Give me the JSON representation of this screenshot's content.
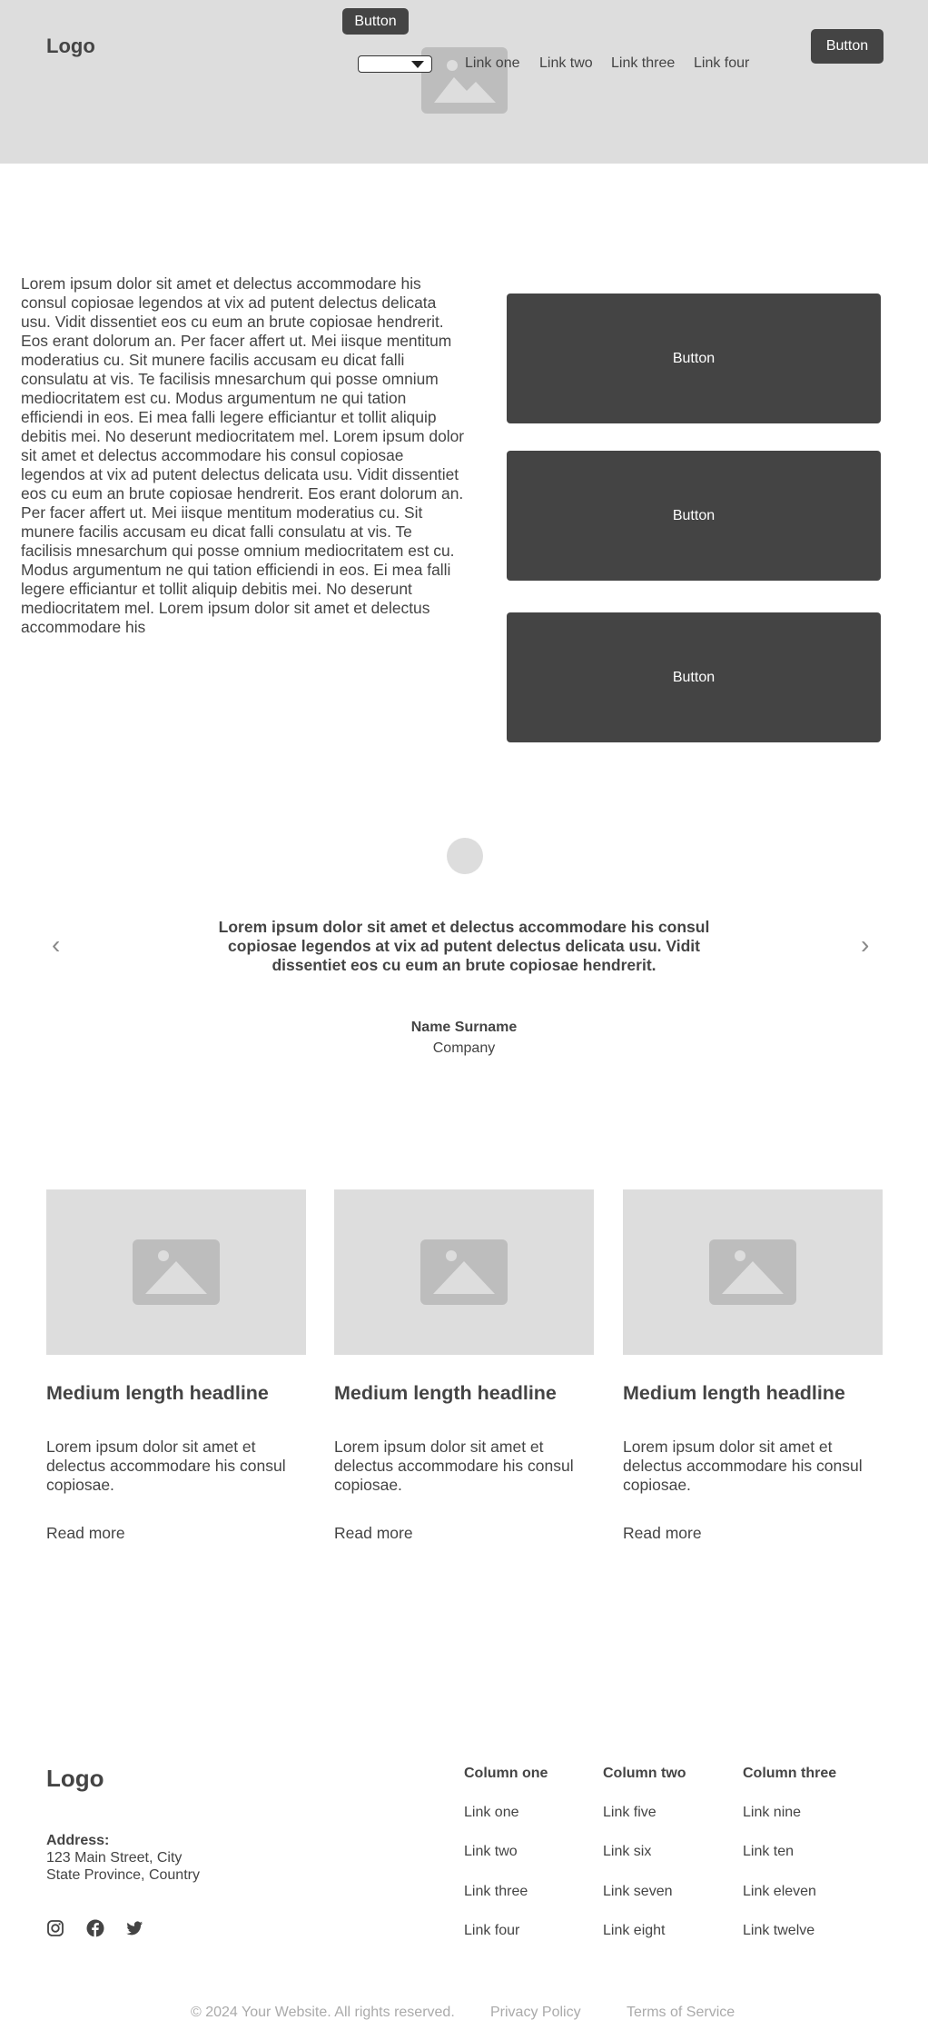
{
  "header": {
    "logo": "Logo",
    "top_button": "Button",
    "cta_button": "Button",
    "nav_links": [
      "Link one",
      "Link two",
      "Link three",
      "Link four"
    ]
  },
  "content": {
    "paragraph": "Lorem ipsum dolor sit amet et delectus accommodare his consul copiosae legendos at vix ad putent delectus delicata usu. Vidit dissentiet eos cu eum an brute copiosae hendrerit. Eos erant dolorum an. Per facer affert ut. Mei iisque mentitum moderatius cu. Sit munere facilis accusam eu dicat falli consulatu at vis. Te facilisis mnesarchum qui posse omnium mediocritatem est cu. Modus argumentum ne qui tation efficiendi in eos. Ei mea falli legere efficiantur et tollit aliquip debitis mei. No deserunt mediocritatem mel. Lorem ipsum dolor sit amet et delectus accommodare his consul copiosae legendos at vix ad putent delectus delicata usu. Vidit dissentiet eos cu eum an brute copiosae hendrerit. Eos erant dolorum an. Per facer affert ut. Mei iisque mentitum moderatius cu. Sit munere facilis accusam eu dicat falli consulatu at vis. Te facilisis mnesarchum qui posse omnium mediocritatem est cu. Modus argumentum ne qui tation efficiendi in eos. Ei mea falli legere efficiantur et tollit aliquip debitis mei. No deserunt mediocritatem mel. Lorem ipsum dolor sit amet et delectus accommodare his",
    "buttons": [
      "Button",
      "Button",
      "Button"
    ]
  },
  "testimonial": {
    "quote": "Lorem ipsum dolor sit amet et delectus accommodare his consul copiosae legendos at vix ad putent delectus delicata usu. Vidit dissentiet eos cu eum an brute copiosae hendrerit.",
    "name": "Name Surname",
    "company": "Company",
    "prev_icon": "‹",
    "next_icon": "›"
  },
  "cards": [
    {
      "title": "Medium length headline",
      "text": "Lorem ipsum dolor sit amet et delectus accommodare his consul copiosae.",
      "link": "Read more"
    },
    {
      "title": "Medium length headline",
      "text": "Lorem ipsum dolor sit amet et delectus accommodare his consul copiosae.",
      "link": "Read more"
    },
    {
      "title": "Medium length headline",
      "text": "Lorem ipsum dolor sit amet et delectus accommodare his consul copiosae.",
      "link": "Read more"
    }
  ],
  "footer": {
    "logo": "Logo",
    "address_label": "Address:",
    "address_lines": [
      "123 Main Street, City",
      "State Province, Country"
    ],
    "columns": [
      {
        "heading": "Column one",
        "links": [
          "Link one",
          "Link two",
          "Link three",
          "Link four"
        ]
      },
      {
        "heading": "Column two",
        "links": [
          "Link five",
          "Link six",
          "Link seven",
          "Link eight"
        ]
      },
      {
        "heading": "Column three",
        "links": [
          "Link nine",
          "Link ten",
          "Link eleven",
          "Link twelve"
        ]
      }
    ],
    "copyright": "© 2024 Your Website. All rights reserved.",
    "privacy": "Privacy Policy",
    "terms": "Terms of Service",
    "social_icons": [
      "instagram-icon",
      "facebook-icon",
      "twitter-icon"
    ]
  },
  "colors": {
    "header_bg": "#dddddd",
    "button_bg": "#444444",
    "text": "#444444",
    "muted": "#aaaaaa"
  }
}
